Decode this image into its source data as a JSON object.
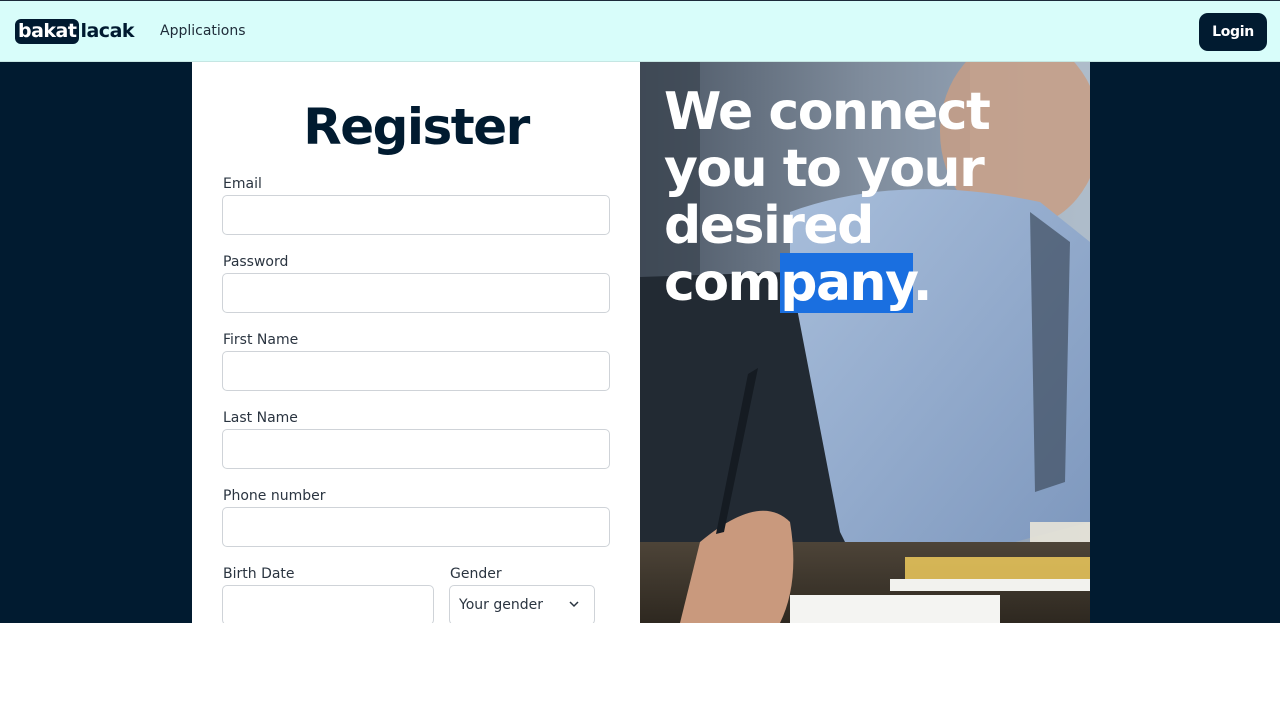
{
  "navbar": {
    "logo_part1": "bakat",
    "logo_part2": "lacak",
    "nav_applications": "Applications",
    "login_label": "Login"
  },
  "form": {
    "title": "Register",
    "email_label": "Email",
    "password_label": "Password",
    "first_name_label": "First Name",
    "last_name_label": "Last Name",
    "phone_label": "Phone number",
    "birth_date_label": "Birth Date",
    "gender_label": "Gender",
    "gender_placeholder": "Your gender"
  },
  "hero": {
    "headline_part1": "We connect you to your desired com",
    "headline_highlight": "pany",
    "headline_part2": "."
  },
  "colors": {
    "navbar_bg": "#d8fdfa",
    "brand_dark": "#011b30",
    "highlight": "#1a6fe0"
  }
}
